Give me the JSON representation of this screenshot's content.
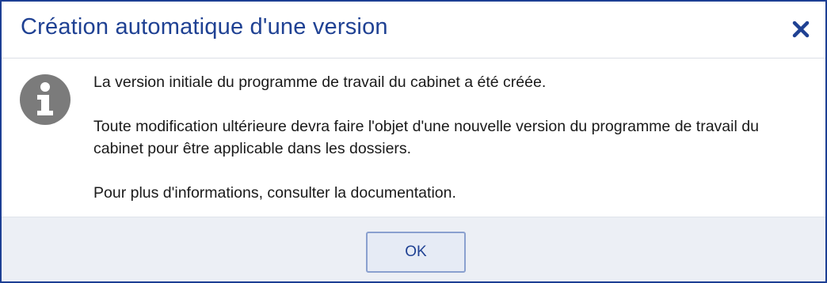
{
  "dialog": {
    "title": "Création automatique d'une version",
    "close_icon": "close-icon",
    "info_icon": "info-icon",
    "messages": [
      "La version initiale du programme de travail du cabinet a été créée.",
      "Toute modification ultérieure devra faire l'objet d'une nouvelle version du programme de travail du cabinet pour être applicable dans les dossiers.",
      "Pour plus d'informations, consulter la documentation."
    ],
    "ok_label": "OK"
  },
  "colors": {
    "accent": "#1f4193",
    "border": "#1d3f94",
    "footer_bg": "#eceff5",
    "icon_gray": "#7b7b7b"
  }
}
